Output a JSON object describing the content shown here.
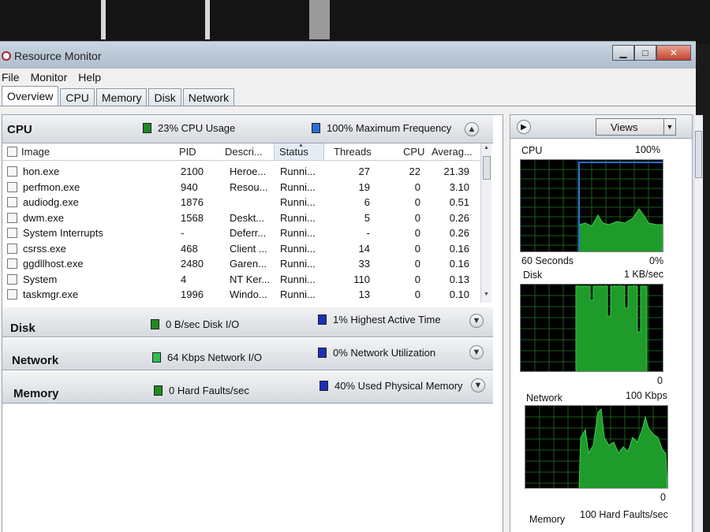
{
  "window": {
    "title": "Resource Monitor",
    "min": "▁",
    "max": "□",
    "close": "✕"
  },
  "menu": [
    "File",
    "Monitor",
    "Help"
  ],
  "tabs": [
    "Overview",
    "CPU",
    "Memory",
    "Disk",
    "Network"
  ],
  "sections": {
    "cpu": {
      "title": "CPU",
      "legend1": "23% CPU Usage",
      "legend2": "100% Maximum Frequency",
      "color1": "#1f8a1f",
      "color2": "#2a6fd6"
    },
    "disk": {
      "title": "Disk",
      "legend1": "0 B/sec Disk I/O",
      "legend2": "1% Highest Active Time",
      "color1": "#1f8a1f",
      "color2": "#1a2fb8"
    },
    "network": {
      "title": "Network",
      "legend1": "64 Kbps Network I/O",
      "legend2": "0% Network Utilization",
      "color1": "#2fbf4f",
      "color2": "#1a2fb8"
    },
    "memory": {
      "title": "Memory",
      "legend1": "0 Hard Faults/sec",
      "legend2": "40% Used Physical Memory",
      "color1": "#1f8a1f",
      "color2": "#1a2fb8"
    }
  },
  "cpu_table": {
    "columns": [
      "Image",
      "PID",
      "Descri...",
      "Status",
      "Threads",
      "CPU",
      "Averag..."
    ],
    "rows": [
      [
        "hon.exe",
        "2100",
        "Heroe...",
        "Runni...",
        "27",
        "22",
        "21.39"
      ],
      [
        "perfmon.exe",
        "940",
        "Resou...",
        "Runni...",
        "19",
        "0",
        "3.10"
      ],
      [
        "audiodg.exe",
        "1876",
        "",
        "Runni...",
        "6",
        "0",
        "0.51"
      ],
      [
        "dwm.exe",
        "1568",
        "Deskt...",
        "Runni...",
        "5",
        "0",
        "0.26"
      ],
      [
        "System Interrupts",
        "-",
        "Deferr...",
        "Runni...",
        "-",
        "0",
        "0.26"
      ],
      [
        "csrss.exe",
        "468",
        "Client ...",
        "Runni...",
        "14",
        "0",
        "0.16"
      ],
      [
        "ggdllhost.exe",
        "2480",
        "Garen...",
        "Runni...",
        "33",
        "0",
        "0.16"
      ],
      [
        "System",
        "4",
        "NT Ker...",
        "Runni...",
        "110",
        "0",
        "0.13"
      ],
      [
        "taskmgr.exe",
        "1996",
        "Windo...",
        "Runni...",
        "13",
        "0",
        "0.10"
      ]
    ]
  },
  "monitor": {
    "views_label": "Views",
    "cpu": {
      "label": "CPU",
      "max": "100%",
      "time": "60 Seconds",
      "min": "0%"
    },
    "disk": {
      "label": "Disk",
      "max": "1 KB/sec",
      "min": "0"
    },
    "network": {
      "label": "Network",
      "max": "100 Kbps",
      "min": "0"
    },
    "memory": {
      "label": "Memory",
      "max": "100 Hard Faults/sec"
    }
  }
}
